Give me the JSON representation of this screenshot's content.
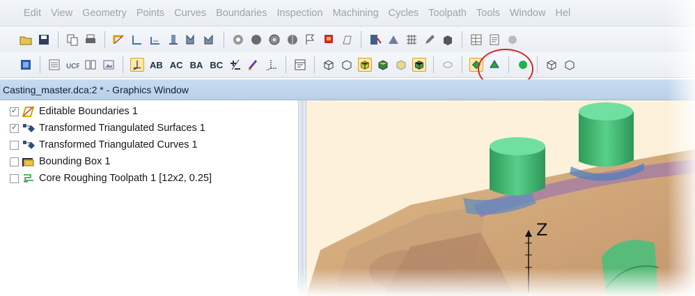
{
  "menu": [
    "Edit",
    "View",
    "Geometry",
    "Points",
    "Curves",
    "Boundaries",
    "Inspection",
    "Machining",
    "Cycles",
    "Toolpath",
    "Tools",
    "Window",
    "Hel"
  ],
  "toolbar2_text": [
    "AB",
    "AC",
    "BA",
    "BC"
  ],
  "window_title": "Casting_master.dca:2 * - Graphics Window",
  "tree": [
    {
      "label": "Editable Boundaries 1",
      "checked": true,
      "icon": "boundary-icon"
    },
    {
      "label": "Transformed Triangulated Surfaces 1",
      "checked": true,
      "icon": "surfaces-icon"
    },
    {
      "label": "Transformed Triangulated Curves 1",
      "checked": false,
      "icon": "curves-icon"
    },
    {
      "label": "Bounding Box 1",
      "checked": false,
      "icon": "bounding-box-icon"
    },
    {
      "label": "Core Roughing Toolpath 1 [12x2, 0.25]",
      "checked": false,
      "icon": "toolpath-icon"
    }
  ],
  "axis_z_label": "Z",
  "colors": {
    "highlight": "#d8232a",
    "viewport_bg": "#fdf1dc",
    "boss_green": "#3fbf7a"
  }
}
